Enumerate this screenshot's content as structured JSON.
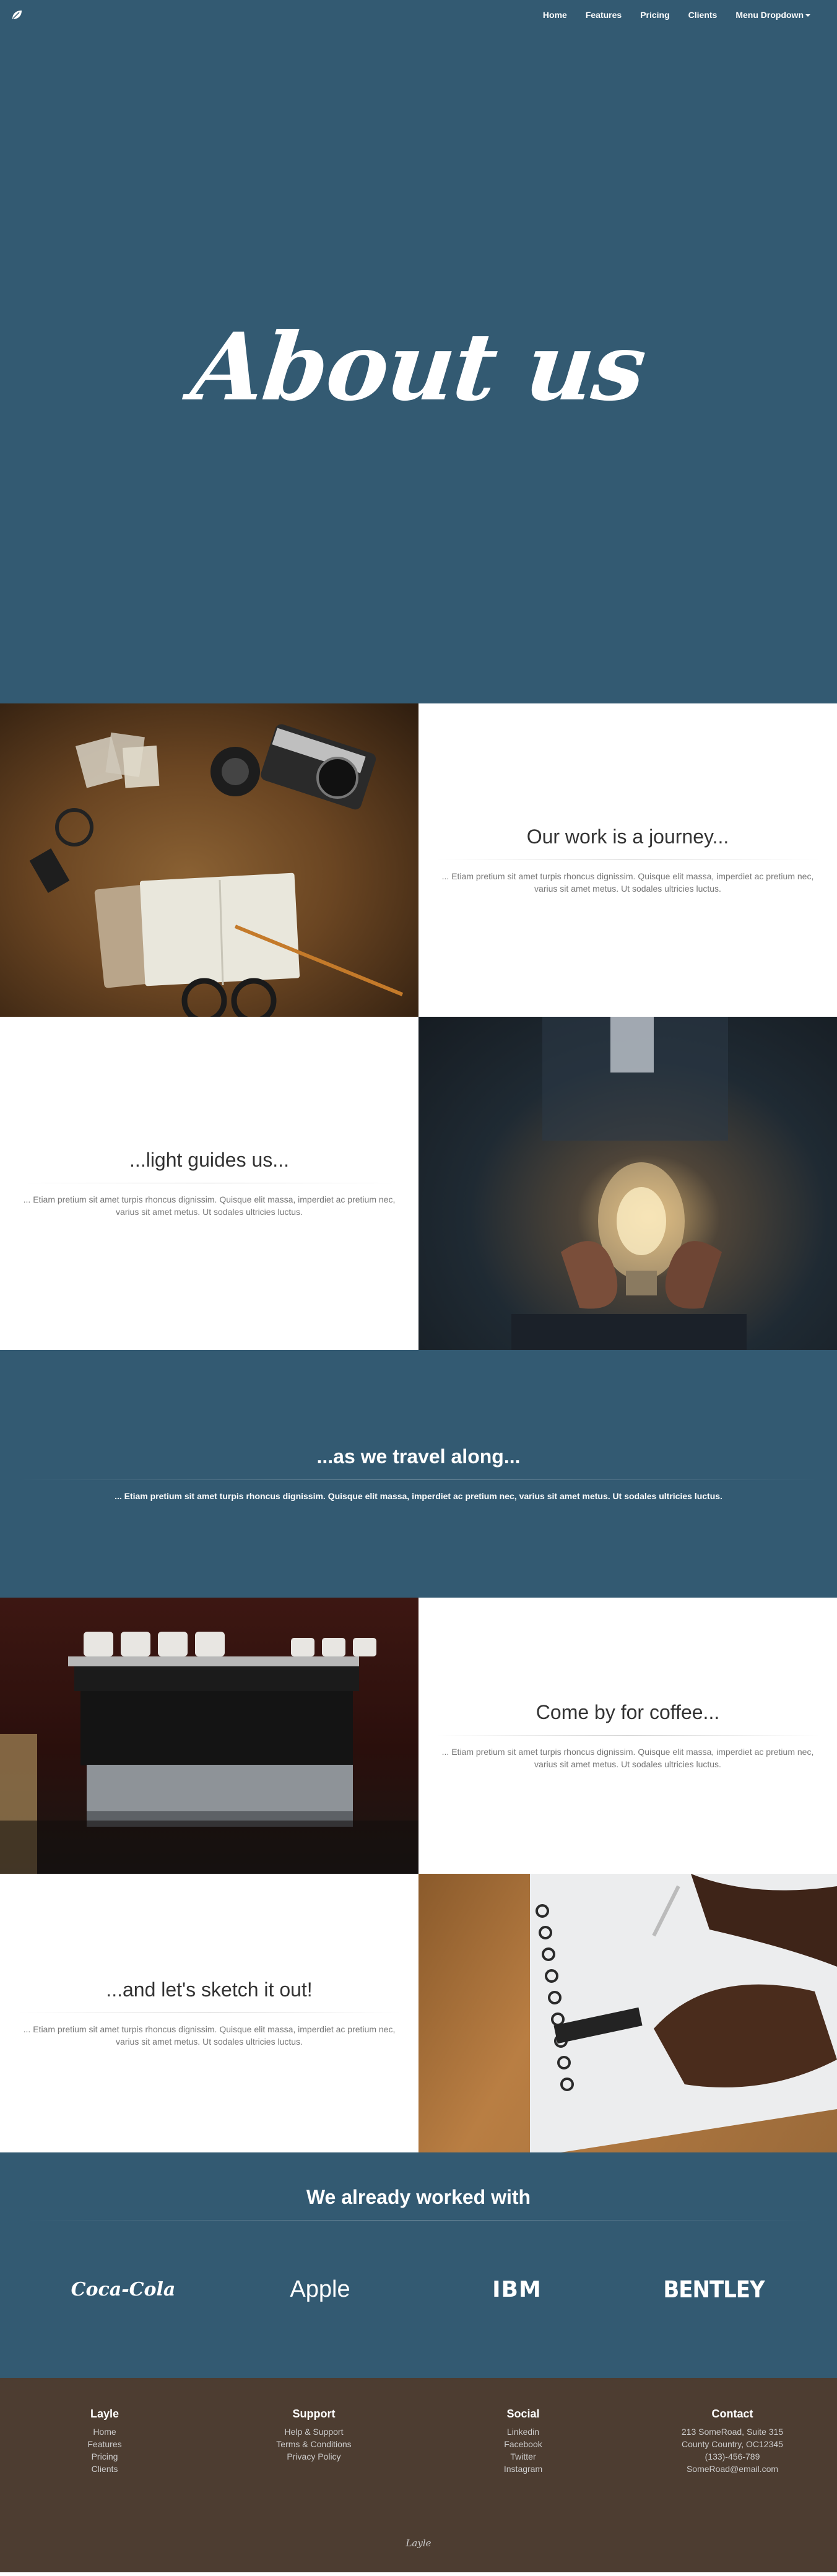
{
  "nav": {
    "logo_icon": "leaf-icon",
    "links": [
      "Home",
      "Features",
      "Pricing",
      "Clients"
    ],
    "dropdown_label": "Menu Dropdown"
  },
  "hero": {
    "title": "About us"
  },
  "journey": {
    "title": "Our work is a journey...",
    "body": "... Etiam pretium sit amet turpis rhoncus dignissim. Quisque elit massa, imperdiet ac pretium nec, varius sit amet metus. Ut sodales ultricies luctus."
  },
  "light": {
    "title": "...light guides us...",
    "body": "... Etiam pretium sit amet turpis rhoncus dignissim. Quisque elit massa, imperdiet ac pretium nec, varius sit amet metus. Ut sodales ultricies luctus."
  },
  "travel": {
    "title": "...as we travel along...",
    "body": "... Etiam pretium sit amet turpis rhoncus dignissim. Quisque elit massa, imperdiet ac pretium nec, varius sit amet metus. Ut sodales ultricies luctus."
  },
  "coffee": {
    "title": "Come by for coffee...",
    "body": "... Etiam pretium sit amet turpis rhoncus dignissim. Quisque elit massa, imperdiet ac pretium nec, varius sit amet metus. Ut sodales ultricies luctus."
  },
  "sketch": {
    "title": "...and let's sketch it out!",
    "body": "... Etiam pretium sit amet turpis rhoncus dignissim. Quisque elit massa, imperdiet ac pretium nec, varius sit amet metus. Ut sodales ultricies luctus."
  },
  "clients": {
    "title": "We already worked with",
    "logos": [
      "Coca-Cola",
      "Apple",
      "IBM",
      "BENTLEY"
    ]
  },
  "footer": {
    "columns": [
      {
        "title": "Layle",
        "items": [
          "Home",
          "Features",
          "Pricing",
          "Clients"
        ]
      },
      {
        "title": "Support",
        "items": [
          "Help & Support",
          "Terms & Conditions",
          "Privacy Policy"
        ]
      },
      {
        "title": "Social",
        "items": [
          "Linkedin",
          "Facebook",
          "Twitter",
          "Instagram"
        ]
      },
      {
        "title": "Contact",
        "items": [
          "213 SomeRoad, Suite 315",
          "County Country, OC12345",
          "(133)-456-789",
          "SomeRoad@email.com"
        ]
      }
    ],
    "brand": "Layle"
  },
  "colors": {
    "primary": "#335a72",
    "footer_bg": "#4d3d31"
  }
}
